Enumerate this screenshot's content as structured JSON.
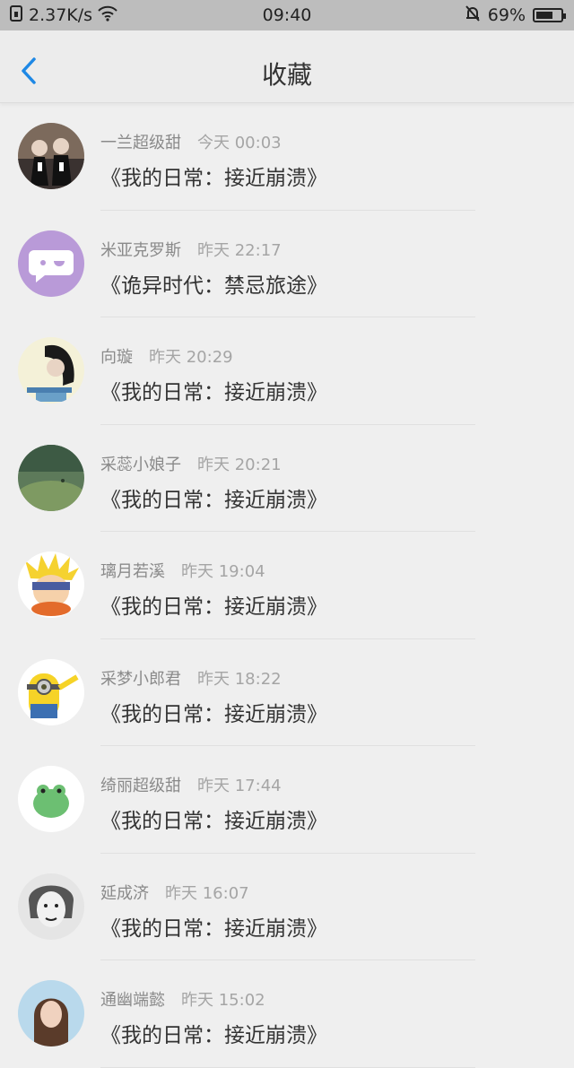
{
  "status": {
    "net_speed": "2.37K/s",
    "time": "09:40",
    "battery": "69%",
    "battery_level": 0.69
  },
  "nav": {
    "title": "收藏"
  },
  "items": [
    {
      "name": "一兰超级甜",
      "time": "今天 00:03",
      "book": "《我的日常：接近崩溃》"
    },
    {
      "name": "米亚克罗斯",
      "time": "昨天 22:17",
      "book": "《诡异时代：禁忌旅途》"
    },
    {
      "name": "向璇",
      "time": "昨天 20:29",
      "book": "《我的日常：接近崩溃》"
    },
    {
      "name": "采蕊小娘子",
      "time": "昨天 20:21",
      "book": "《我的日常：接近崩溃》"
    },
    {
      "name": "璃月若溪",
      "time": "昨天 19:04",
      "book": "《我的日常：接近崩溃》"
    },
    {
      "name": "采梦小郎君",
      "time": "昨天 18:22",
      "book": "《我的日常：接近崩溃》"
    },
    {
      "name": "绮丽超级甜",
      "time": "昨天 17:44",
      "book": "《我的日常：接近崩溃》"
    },
    {
      "name": "延成济",
      "time": "昨天 16:07",
      "book": "《我的日常：接近崩溃》"
    },
    {
      "name": "通幽端懿",
      "time": "昨天 15:02",
      "book": "《我的日常：接近崩溃》"
    }
  ]
}
